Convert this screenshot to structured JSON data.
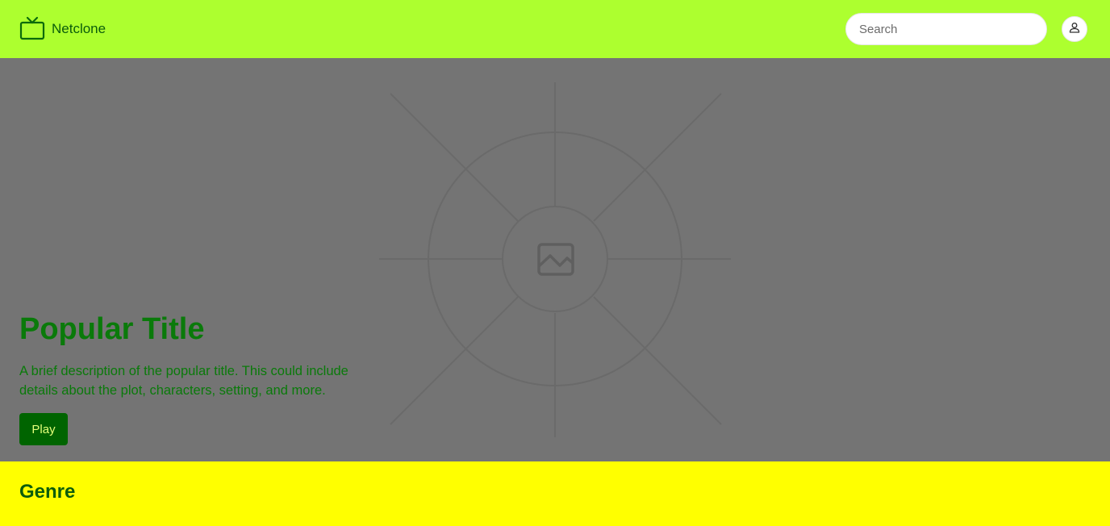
{
  "header": {
    "brand_name": "Netclone",
    "search_placeholder": "Search"
  },
  "hero": {
    "title": "Popular Title",
    "description": "A brief description of the popular title. This could include details about the plot, characters, setting, and more.",
    "play_label": "Play"
  },
  "genre": {
    "title": "Genre"
  },
  "colors": {
    "header_bg": "#adff2f",
    "hero_bg": "#747474",
    "hero_text": "#0a7a0a",
    "play_button": "#006400",
    "genre_bg": "#ffff00"
  },
  "icons": {
    "logo": "tv-icon",
    "avatar": "user-icon",
    "hero_placeholder": "image-icon"
  }
}
